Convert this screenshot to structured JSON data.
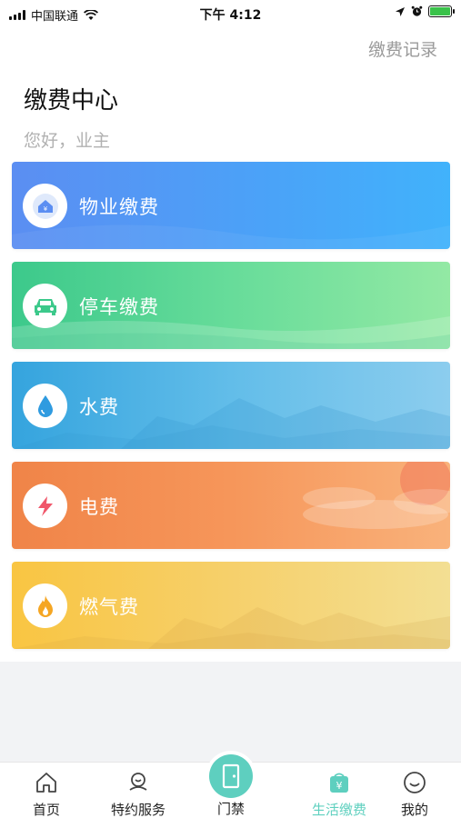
{
  "status_bar": {
    "carrier": "中国联通",
    "time": "下午 4:12"
  },
  "header": {
    "records_link": "缴费记录",
    "title": "缴费中心",
    "greeting": "您好，业主"
  },
  "cards": [
    {
      "label": "物业缴费",
      "icon": "house-yen-icon"
    },
    {
      "label": "停车缴费",
      "icon": "car-icon"
    },
    {
      "label": "水费",
      "icon": "water-drop-icon"
    },
    {
      "label": "电费",
      "icon": "lightning-icon"
    },
    {
      "label": "燃气费",
      "icon": "flame-icon"
    }
  ],
  "tabs": [
    {
      "label": "首页",
      "icon": "home-icon"
    },
    {
      "label": "特约服务",
      "icon": "service-icon"
    },
    {
      "label": "门禁",
      "icon": "door-icon"
    },
    {
      "label": "生活缴费",
      "icon": "payment-bag-icon",
      "active": true
    },
    {
      "label": "我的",
      "icon": "smile-icon"
    }
  ],
  "colors": {
    "accent": "#5ecfbf",
    "property": "#4aa3f8",
    "parking": "#67dc9a",
    "water": "#62bde9",
    "electric": "#f6965a",
    "gas": "#f6d06b"
  }
}
